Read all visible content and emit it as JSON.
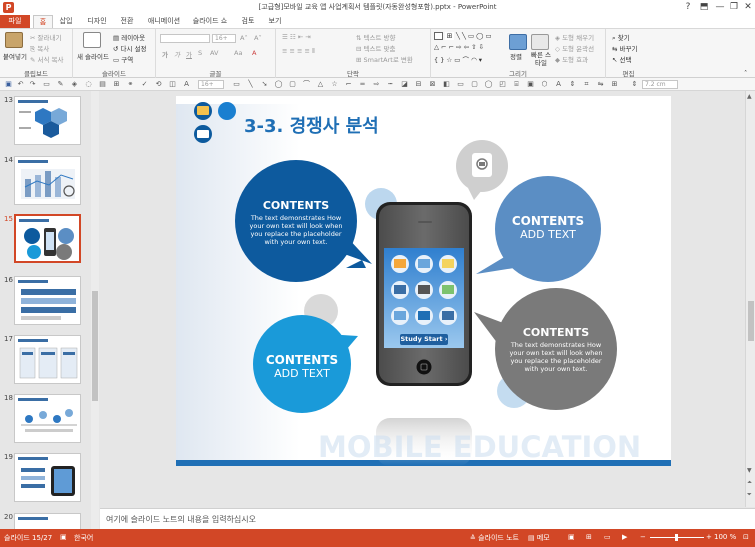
{
  "window": {
    "title": "[고급형]모바일 교육 앱 사업계획서 템플릿(자동완성형포함).pptx - PowerPoint",
    "help": "?",
    "minimize": "—",
    "restore": "❐",
    "close": "✕"
  },
  "tabs": [
    "파일",
    "홈",
    "삽입",
    "디자인",
    "전환",
    "애니메이션",
    "슬라이드 쇼",
    "검토",
    "보기"
  ],
  "ribbon": {
    "clipboard": {
      "paste": "붙여넣기",
      "cut": "잘라내기",
      "copy": "복사",
      "format_painter": "서식 복사",
      "label": "클립보드"
    },
    "slides": {
      "new_slide": "새 슬라이드",
      "layout": "레이아웃",
      "reset": "다시 설정",
      "section": "구역",
      "label": "슬라이드"
    },
    "font": {
      "size_value": "16+",
      "aa": "Aa",
      "label": "글꼴"
    },
    "paragraph": {
      "text_direction": "텍스트 방향",
      "align_text": "텍스트 맞춤",
      "smartart": "SmartArt로 변환",
      "label": "단락"
    },
    "drawing": {
      "arrange": "정렬",
      "quick_styles": "빠른 스타일",
      "shape_fill": "도형 채우기",
      "shape_outline": "도형 윤곽선",
      "shape_effects": "도형 효과",
      "label": "그리기"
    },
    "editing": {
      "find": "찾기",
      "replace": "바꾸기",
      "select": "선택",
      "label": "편집"
    }
  },
  "qat": {
    "size_value": "16+",
    "measure_value": "7.2 cm"
  },
  "thumbnails": [
    {
      "num": "13",
      "selected": false
    },
    {
      "num": "14",
      "selected": false
    },
    {
      "num": "15",
      "selected": true
    },
    {
      "num": "16",
      "selected": false
    },
    {
      "num": "17",
      "selected": false
    },
    {
      "num": "18",
      "selected": false
    },
    {
      "num": "19",
      "selected": false
    },
    {
      "num": "20",
      "selected": false
    }
  ],
  "slide": {
    "title": "3-3. 경쟁사 분석",
    "bubble_tl": {
      "title": "CONTENTS",
      "text": "The text demonstrates How your own text will look when you replace the placeholder with your own text."
    },
    "bubble_tr": {
      "title": "CONTENTS",
      "sub": "ADD TEXT"
    },
    "bubble_bl": {
      "title": "CONTENTS",
      "sub": "ADD TEXT"
    },
    "bubble_br": {
      "title": "CONTENTS",
      "text": "The text demonstrates How your own text will look when you replace the placeholder with your own text."
    },
    "phone_button": "Study Start ›",
    "watermark": "MOBILE EDUCATION",
    "colors": {
      "dark_blue": "#0d5a9e",
      "mid_blue": "#5b8ec4",
      "cyan": "#1a9ad9",
      "gray": "#7a7a7a",
      "light_gray": "#d3d3d3",
      "title_blue": "#1f6fb5"
    }
  },
  "notes": {
    "placeholder": "여기에 슬라이드 노트의 내용을 입력하십시오"
  },
  "status": {
    "slide_num": "슬라이드 15/27",
    "language": "한국어",
    "notes": "슬라이드 노트",
    "comments": "메모",
    "zoom": "100 %"
  }
}
